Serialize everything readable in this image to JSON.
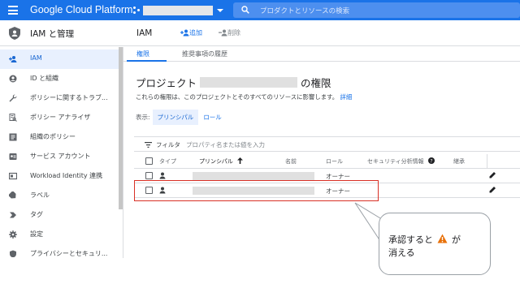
{
  "topbar": {
    "brand": "Google Cloud Platform",
    "search_placeholder": "プロダクトとリソースの検索",
    "accent": "#1a73e8"
  },
  "sidebar": {
    "title": "IAM と管理",
    "items": [
      {
        "label": "IAM",
        "icon": "person-add-icon",
        "active": true
      },
      {
        "label": "ID と組織",
        "icon": "account-circle-icon"
      },
      {
        "label": "ポリシーに関するトラブ...",
        "icon": "wrench-icon"
      },
      {
        "label": "ポリシー アナライザ",
        "icon": "policy-search-icon"
      },
      {
        "label": "組織のポリシー",
        "icon": "list-icon"
      },
      {
        "label": "サービス アカウント",
        "icon": "service-account-icon"
      },
      {
        "label": "Workload Identity 連携",
        "icon": "id-card-icon"
      },
      {
        "label": "ラベル",
        "icon": "label-icon"
      },
      {
        "label": "タグ",
        "icon": "tag-icon"
      },
      {
        "label": "設定",
        "icon": "gear-icon"
      },
      {
        "label": "プライバシーとセキュリ...",
        "icon": "shield-icon"
      }
    ]
  },
  "header": {
    "title": "IAM",
    "add_label": "追加",
    "delete_label": "削除"
  },
  "tabs": [
    {
      "label": "権限",
      "active": true
    },
    {
      "label": "推奨事項の履歴"
    }
  ],
  "permissions": {
    "title_prefix": "プロジェクト",
    "title_suffix": "の権限",
    "description": "これらの権限は、このプロジェクトとそのすべてのリソースに影響します。",
    "details_link": "詳細",
    "view_label": "表示:",
    "view_options": [
      "プリンシパル",
      "ロール"
    ]
  },
  "filter": {
    "label": "フィルタ",
    "placeholder": "プロパティ名または値を入力"
  },
  "table": {
    "headers": [
      "タイプ",
      "プリンシパル",
      "名前",
      "ロール",
      "セキュリティ分析情報",
      "継承"
    ],
    "rows": [
      {
        "role": "オーナー"
      },
      {
        "role": "オーナー"
      }
    ]
  },
  "callout": {
    "line1_before": "承認すると",
    "line1_after": "が",
    "line2": "消える"
  }
}
